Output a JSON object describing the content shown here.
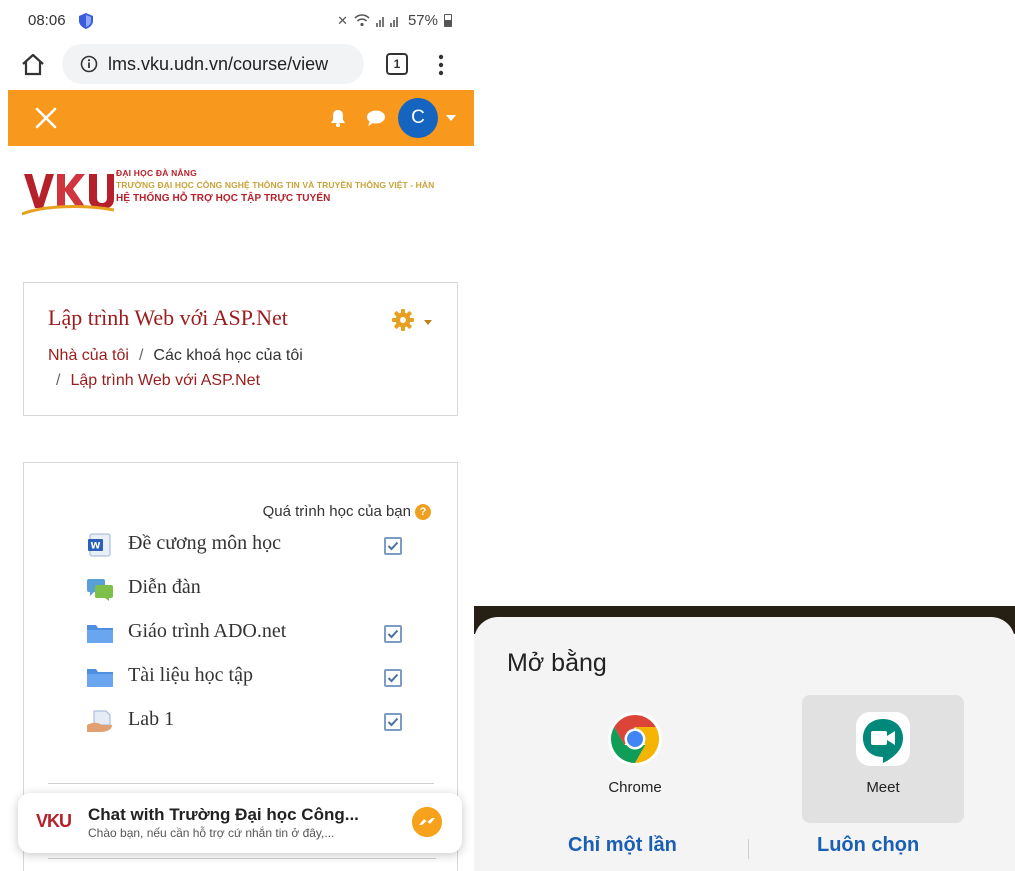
{
  "status_bar": {
    "time": "08:06",
    "battery": "57%"
  },
  "browser": {
    "url": "lms.vku.udn.vn/course/view",
    "tab_count": "1"
  },
  "nav": {
    "avatar_letter": "C"
  },
  "logo": {
    "mark": "VKU",
    "line1": "ĐẠI HỌC ĐÀ NẴNG",
    "line2": "TRƯỜNG ĐẠI HỌC CÔNG NGHỆ THÔNG TIN VÀ TRUYỀN THÔNG VIỆT - HÀN",
    "line3": "HỆ THỐNG HỖ TRỢ HỌC TẬP TRỰC TUYẾN"
  },
  "course": {
    "title": "Lập trình Web với ASP.Net",
    "breadcrumb": [
      "Nhà của tôi",
      "Các khoá học của tôi",
      "Lập trình Web với ASP.Net"
    ],
    "breadcrumb_sep": "/"
  },
  "progress": {
    "label": "Quá trình học của bạn",
    "help": "?"
  },
  "activities": [
    {
      "name": "Đề cương môn học",
      "icon": "word-document-icon",
      "completed": true
    },
    {
      "name": "Diễn đàn",
      "icon": "forum-icon",
      "completed": null
    },
    {
      "name": "Giáo trình ADO.net",
      "icon": "folder-icon",
      "completed": true
    },
    {
      "name": "Tài liệu học tập",
      "icon": "folder-icon",
      "completed": true
    },
    {
      "name": "Lab 1",
      "icon": "assignment-icon",
      "completed": true
    }
  ],
  "chat": {
    "logo": "VKU",
    "title": "Chat with Trường Đại học Công...",
    "subtitle": "Chào bạn, nếu cần hỗ trợ cứ nhắn tin ở đây,..."
  },
  "open_with": {
    "title": "Mở bằng",
    "apps": [
      {
        "label": "Chrome",
        "icon": "chrome-icon",
        "selected": false
      },
      {
        "label": "Meet",
        "icon": "meet-icon",
        "selected": true
      }
    ],
    "just_once": "Chỉ một lần",
    "always": "Luôn chọn"
  },
  "colors": {
    "nav_orange": "#f8981d",
    "link_red": "#9b1c1c",
    "avatar_blue": "#1565c0",
    "button_blue": "#1a5fb4"
  }
}
